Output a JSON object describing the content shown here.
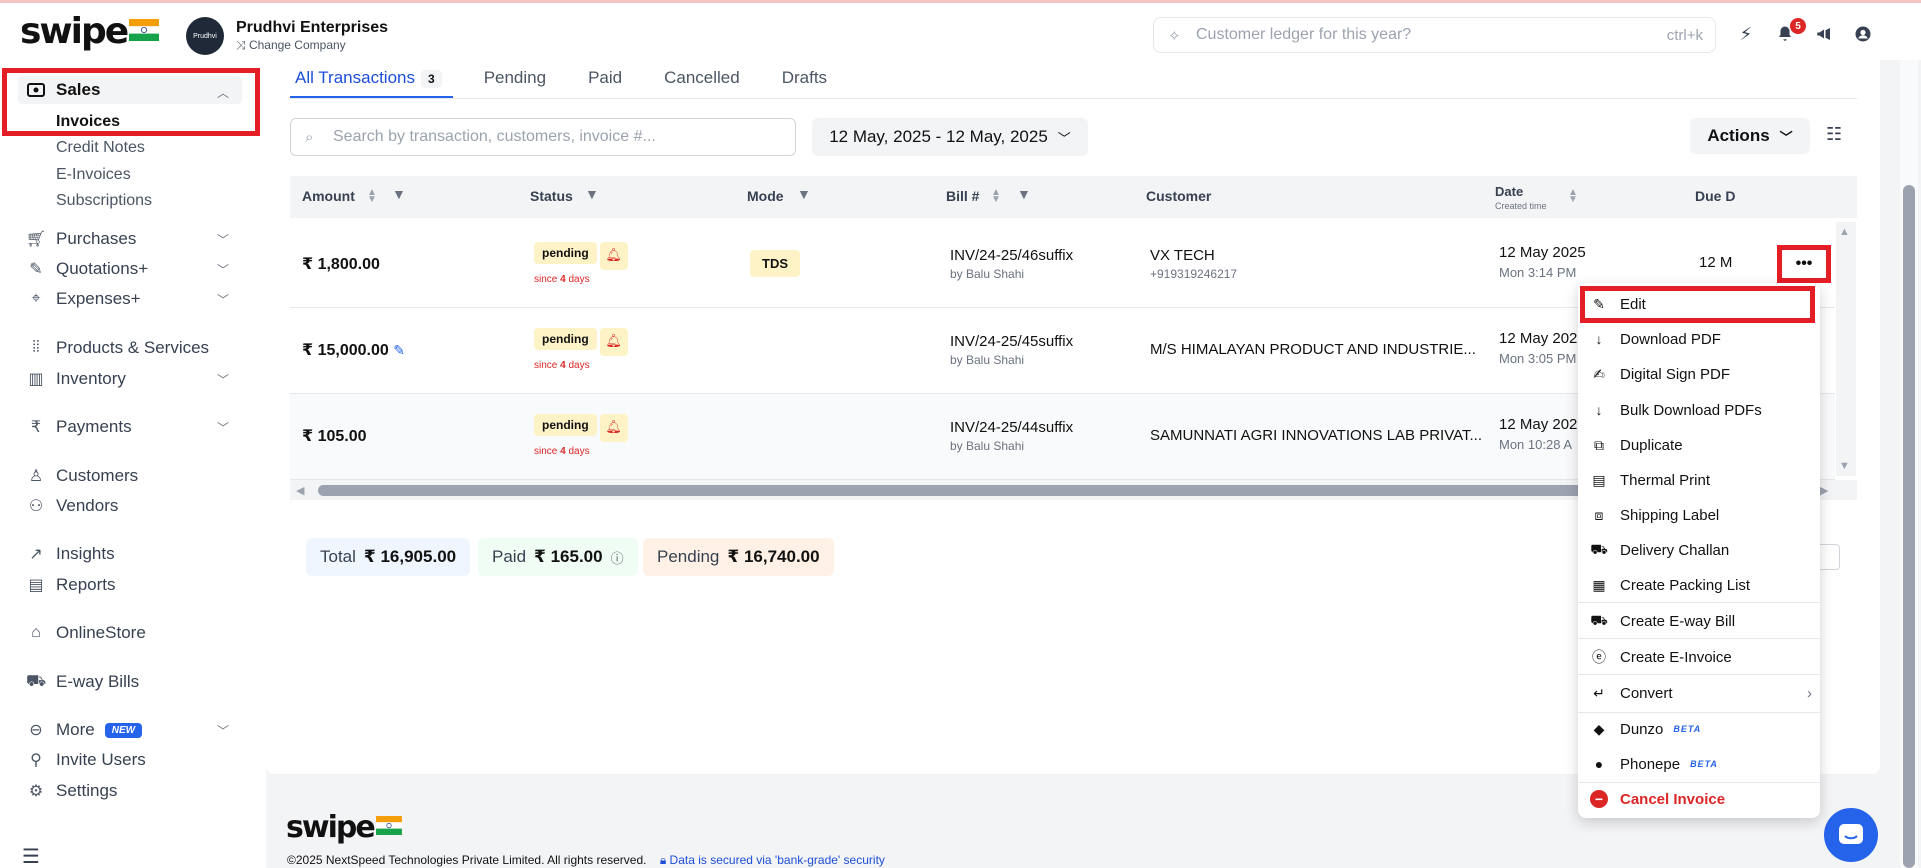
{
  "header": {
    "logo_text": "swipe",
    "company_avatar_text": "Prudhvi",
    "company_name": "Prudhvi Enterprises",
    "change_company": "Change Company",
    "search_placeholder": "Customer ledger for this year?",
    "search_shortcut": "ctrl+k",
    "notification_count": "5"
  },
  "sidebar": {
    "sales": "Sales",
    "sales_sub": [
      "Invoices",
      "Credit Notes",
      "E-Invoices",
      "Subscriptions"
    ],
    "purchases": "Purchases",
    "quotations": "Quotations+",
    "expenses": "Expenses+",
    "products": "Products & Services",
    "inventory": "Inventory",
    "payments": "Payments",
    "customers": "Customers",
    "vendors": "Vendors",
    "insights": "Insights",
    "reports": "Reports",
    "onlinestore": "OnlineStore",
    "ewaybills": "E-way Bills",
    "more": "More",
    "more_badge": "NEW",
    "invite": "Invite Users",
    "settings": "Settings"
  },
  "tabs": {
    "all": "All Transactions",
    "all_count": "3",
    "pending": "Pending",
    "paid": "Paid",
    "cancelled": "Cancelled",
    "drafts": "Drafts"
  },
  "toolbar": {
    "search_placeholder": "Search by transaction, customers, invoice #...",
    "date_range": "12 May, 2025 - 12 May, 2025",
    "actions": "Actions"
  },
  "table": {
    "headers": {
      "amount": "Amount",
      "status": "Status",
      "mode": "Mode",
      "bill": "Bill #",
      "customer": "Customer",
      "date": "Date",
      "date_sub": "Created time",
      "due": "Due D"
    },
    "rows": [
      {
        "amount": "₹ 1,800.00",
        "status": "pending",
        "since_pre": "since ",
        "since_num": "4",
        "since_post": " days",
        "mode": "TDS",
        "bill": "INV/24-25/46suffix",
        "by": "by Balu Shahi",
        "customer": "VX TECH",
        "phone": "+919319246217",
        "date": "12 May 2025",
        "time": "Mon 3:14 PM",
        "due": "12 M"
      },
      {
        "amount": "₹ 15,000.00",
        "status": "pending",
        "since_pre": "since ",
        "since_num": "4",
        "since_post": " days",
        "mode": "",
        "bill": "INV/24-25/45suffix",
        "by": "by Balu Shahi",
        "customer": "M/S HIMALAYAN PRODUCT AND INDUSTRIE...",
        "phone": "",
        "date": "12 May 202",
        "time": "Mon 3:05 PM",
        "due": ""
      },
      {
        "amount": "₹ 105.00",
        "status": "pending",
        "since_pre": "since ",
        "since_num": "4",
        "since_post": " days",
        "mode": "",
        "bill": "INV/24-25/44suffix",
        "by": "by Balu Shahi",
        "customer": "SAMUNNATI AGRI INNOVATIONS LAB PRIVAT...",
        "phone": "",
        "date": "12 May 202",
        "time": "Mon 10:28 A",
        "due": ""
      }
    ]
  },
  "summary": {
    "total_label": "Total",
    "total_value": "₹ 16,905.00",
    "paid_label": "Paid",
    "paid_value": "₹ 165.00",
    "pending_label": "Pending",
    "pending_value": "₹ 16,740.00"
  },
  "menu": {
    "edit": "Edit",
    "download_pdf": "Download PDF",
    "digital_sign": "Digital Sign PDF",
    "bulk_download": "Bulk Download PDFs",
    "duplicate": "Duplicate",
    "thermal": "Thermal Print",
    "shipping": "Shipping Label",
    "delivery": "Delivery Challan",
    "packing": "Create Packing List",
    "eway": "Create E-way Bill",
    "einvoice": "Create E-Invoice",
    "convert": "Convert",
    "dunzo": "Dunzo",
    "phonepe": "Phonepe",
    "beta": "BETA",
    "cancel": "Cancel Invoice"
  },
  "footer": {
    "logo_text": "swipe",
    "copyright": "©2025 NextSpeed Technologies Private Limited. All rights reserved.",
    "secure": "Data is secured via 'bank-grade' security"
  },
  "colors": {
    "accent": "#2563eb",
    "highlight_box": "#e41e26",
    "pending_bg": "#fef3c7",
    "danger": "#dc2626"
  }
}
